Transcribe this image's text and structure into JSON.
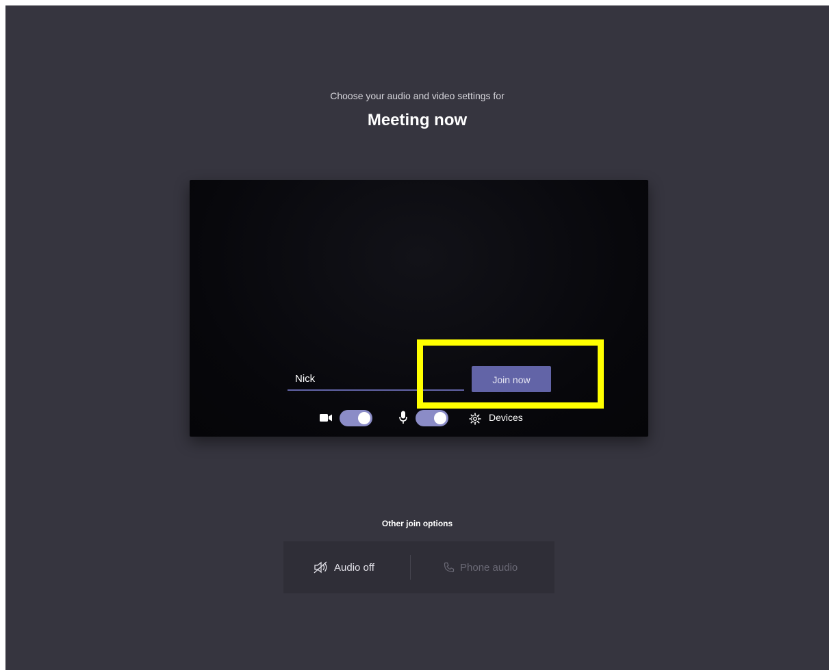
{
  "header": {
    "subtitle": "Choose your audio and video settings for",
    "meeting_title": "Meeting now"
  },
  "preview": {
    "name_value": "Nick",
    "join_label": "Join now",
    "camera_on": true,
    "mic_on": true,
    "devices_label": "Devices"
  },
  "other_options": {
    "title": "Other join options",
    "audio_off_label": "Audio off",
    "phone_audio_label": "Phone audio"
  },
  "colors": {
    "background": "#36353f",
    "accent": "#6264a7",
    "toggle_on": "#8b8cc7",
    "highlight": "#ffff00"
  },
  "icons": [
    "camera-icon",
    "microphone-icon",
    "gear-icon",
    "speaker-off-icon",
    "phone-icon"
  ]
}
